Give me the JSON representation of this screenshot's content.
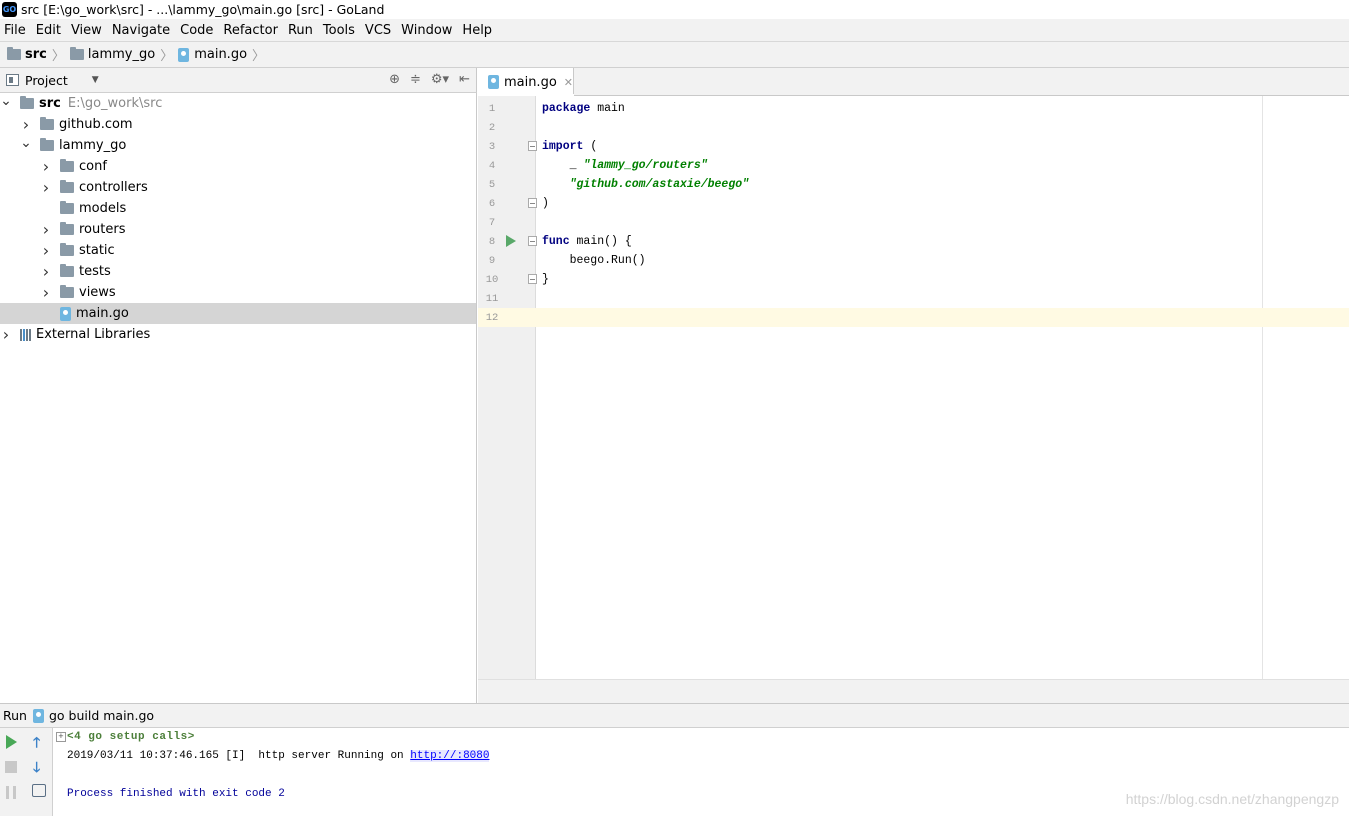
{
  "window": {
    "title": "src [E:\\go_work\\src] - ...\\lammy_go\\main.go [src] - GoLand",
    "logo_text": "GO"
  },
  "menu": [
    "File",
    "Edit",
    "View",
    "Navigate",
    "Code",
    "Refactor",
    "Run",
    "Tools",
    "VCS",
    "Window",
    "Help"
  ],
  "breadcrumb": [
    "src",
    "lammy_go",
    "main.go"
  ],
  "project_panel": {
    "title": "Project",
    "tree": [
      {
        "label": "src",
        "sub": "E:\\go_work\\src",
        "expanded": true,
        "type": "folder",
        "depth": 0
      },
      {
        "label": "github.com",
        "expanded": false,
        "type": "folder",
        "depth": 1
      },
      {
        "label": "lammy_go",
        "expanded": true,
        "type": "folder",
        "depth": 1
      },
      {
        "label": "conf",
        "expanded": false,
        "type": "folder",
        "depth": 2
      },
      {
        "label": "controllers",
        "expanded": false,
        "type": "folder",
        "depth": 2
      },
      {
        "label": "models",
        "type": "folder",
        "depth": 2,
        "leaf": true
      },
      {
        "label": "routers",
        "expanded": false,
        "type": "folder",
        "depth": 2
      },
      {
        "label": "static",
        "expanded": false,
        "type": "folder",
        "depth": 2
      },
      {
        "label": "tests",
        "expanded": false,
        "type": "folder",
        "depth": 2
      },
      {
        "label": "views",
        "expanded": false,
        "type": "folder",
        "depth": 2
      },
      {
        "label": "main.go",
        "type": "gofile",
        "depth": 2,
        "leaf": true,
        "selected": true
      },
      {
        "label": "External Libraries",
        "expanded": false,
        "type": "library",
        "depth": 0
      }
    ]
  },
  "editor": {
    "tab": "main.go",
    "current_line": 12,
    "lines": [
      {
        "n": "1",
        "tokens": [
          [
            "kw",
            "package"
          ],
          [
            "",
            " main"
          ]
        ]
      },
      {
        "n": "2",
        "tokens": []
      },
      {
        "n": "3",
        "tokens": [
          [
            "kw",
            "import"
          ],
          [
            "",
            " ("
          ]
        ],
        "fold": true
      },
      {
        "n": "4",
        "tokens": [
          [
            "",
            "    _ "
          ],
          [
            "str",
            "\"lammy_go/routers\""
          ]
        ]
      },
      {
        "n": "5",
        "tokens": [
          [
            "",
            "    "
          ],
          [
            "str",
            "\"github.com/astaxie/beego\""
          ]
        ]
      },
      {
        "n": "6",
        "tokens": [
          [
            "",
            ")"
          ]
        ],
        "fold": true
      },
      {
        "n": "7",
        "tokens": []
      },
      {
        "n": "8",
        "tokens": [
          [
            "kw",
            "func"
          ],
          [
            "",
            " main() {"
          ]
        ],
        "fold": true,
        "run": true
      },
      {
        "n": "9",
        "tokens": [
          [
            "",
            "    beego.Run()"
          ]
        ]
      },
      {
        "n": "10",
        "tokens": [
          [
            "",
            "}"
          ]
        ],
        "fold": true
      },
      {
        "n": "11",
        "tokens": []
      },
      {
        "n": "12",
        "tokens": []
      }
    ]
  },
  "run_panel": {
    "label": "Run",
    "config": "go build main.go",
    "setup_calls": "<4 go setup calls>",
    "log_prefix": "2019/03/11 10:37:46.165 [I]  http server Running on ",
    "log_link": "http://:8080",
    "process": "Process finished with exit code 2"
  },
  "watermark": "https://blog.csdn.net/zhangpengzp"
}
